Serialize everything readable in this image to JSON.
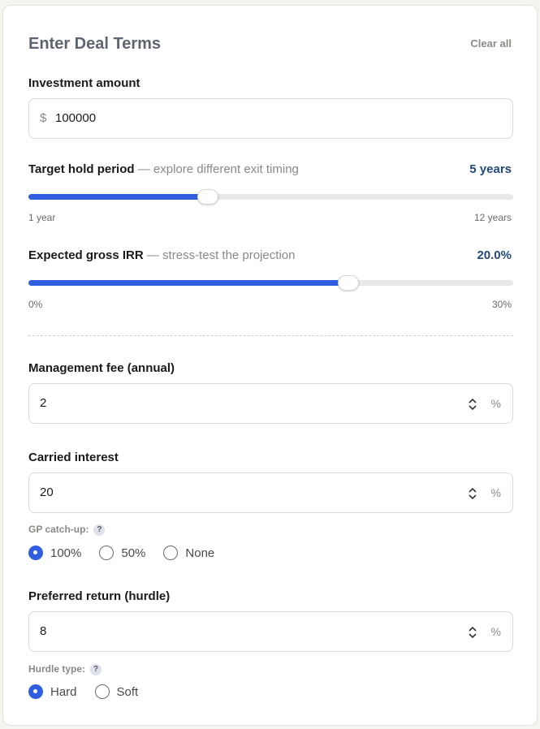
{
  "header": {
    "title": "Enter Deal Terms",
    "clear_label": "Clear all"
  },
  "investment": {
    "label": "Investment amount",
    "currency": "$",
    "value": "100000"
  },
  "hold_period": {
    "label": "Target hold period",
    "hint": "— explore different exit timing",
    "display": "5 years",
    "min_label": "1 year",
    "max_label": "12 years",
    "min": 1,
    "max": 12,
    "value": 5
  },
  "gross_irr": {
    "label": "Expected gross IRR",
    "hint": "— stress-test the projection",
    "display": "20.0%",
    "min_label": "0%",
    "max_label": "30%",
    "min": 0,
    "max": 30,
    "value": 20
  },
  "management_fee": {
    "label": "Management fee (annual)",
    "value": "2",
    "unit": "%"
  },
  "carried_interest": {
    "label": "Carried interest",
    "value": "20",
    "unit": "%"
  },
  "gp_catchup": {
    "label": "GP catch-up:",
    "help": "?",
    "options": [
      "100%",
      "50%",
      "None"
    ],
    "selected": "100%"
  },
  "preferred_return": {
    "label": "Preferred return (hurdle)",
    "value": "8",
    "unit": "%"
  },
  "hurdle_type": {
    "label": "Hurdle type:",
    "help": "?",
    "options": [
      "Hard",
      "Soft"
    ],
    "selected": "Hard"
  },
  "colors": {
    "accent": "#2f5fe0",
    "value_text": "#23487a"
  }
}
